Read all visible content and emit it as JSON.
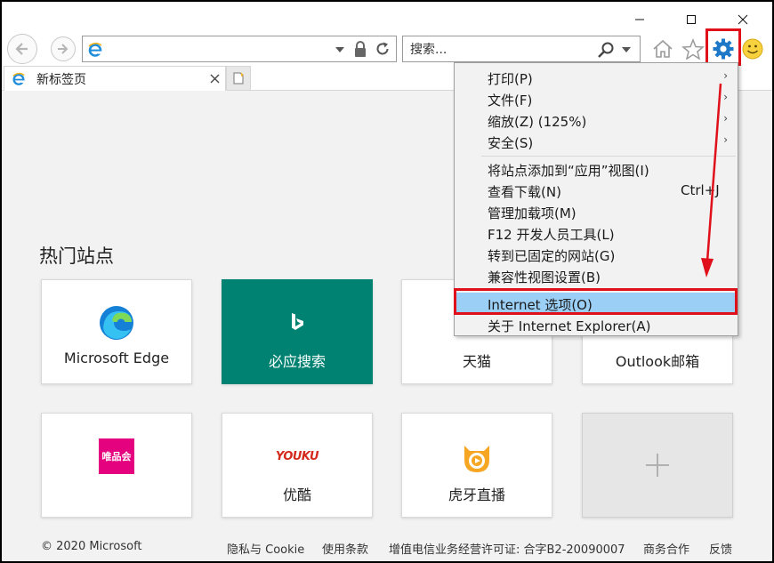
{
  "address": {
    "value": "",
    "placeholder": ""
  },
  "search": {
    "placeholder": "搜索..."
  },
  "tab": {
    "title": "新标签页"
  },
  "content": {
    "hot_sites_title": "热门站点",
    "tiles": [
      {
        "label": "Microsoft Edge",
        "icon": "edge-logo-icon"
      },
      {
        "label": "必应搜索",
        "icon": "bing-logo-icon"
      },
      {
        "label": "天猫",
        "icon": "tmall-logo-icon"
      },
      {
        "label": "Outlook邮箱",
        "icon": "outlook-logo-icon"
      },
      {
        "label": "",
        "icon": "vip-logo-icon",
        "logo_text": "唯品会"
      },
      {
        "label": "优酷",
        "icon": "youku-logo-icon",
        "logo_text": "YOUKU"
      },
      {
        "label": "虎牙直播",
        "icon": "huya-logo-icon"
      },
      {
        "label": "",
        "icon": "add-site-icon"
      }
    ]
  },
  "footer": {
    "copyright": "© 2020 Microsoft",
    "privacy": "隐私与 Cookie",
    "terms": "使用条款",
    "license": "增值电信业务经营许可证: 合字B2-20090007",
    "cooperation": "商务合作",
    "feedback": "反馈"
  },
  "tools_menu": {
    "items": [
      {
        "label": "打印(P)",
        "submenu": true
      },
      {
        "label": "文件(F)",
        "submenu": true
      },
      {
        "label": "缩放(Z) (125%)",
        "submenu": true
      },
      {
        "label": "安全(S)",
        "submenu": true
      },
      {
        "label": "将站点添加到“应用”视图(I)"
      },
      {
        "label": "查看下载(N)",
        "shortcut": "Ctrl+J"
      },
      {
        "label": "管理加载项(M)"
      },
      {
        "label": "F12 开发人员工具(L)"
      },
      {
        "label": "转到已固定的网站(G)"
      },
      {
        "label": "兼容性视图设置(B)"
      },
      {
        "label": "Internet 选项(O)",
        "highlighted": true
      },
      {
        "label": "关于 Internet Explorer(A)"
      }
    ]
  },
  "colors": {
    "bing_tile": "#008272",
    "annotation_red": "#e0101b",
    "menu_highlight": "#9ccff5",
    "gear_blue": "#1e78c8"
  }
}
